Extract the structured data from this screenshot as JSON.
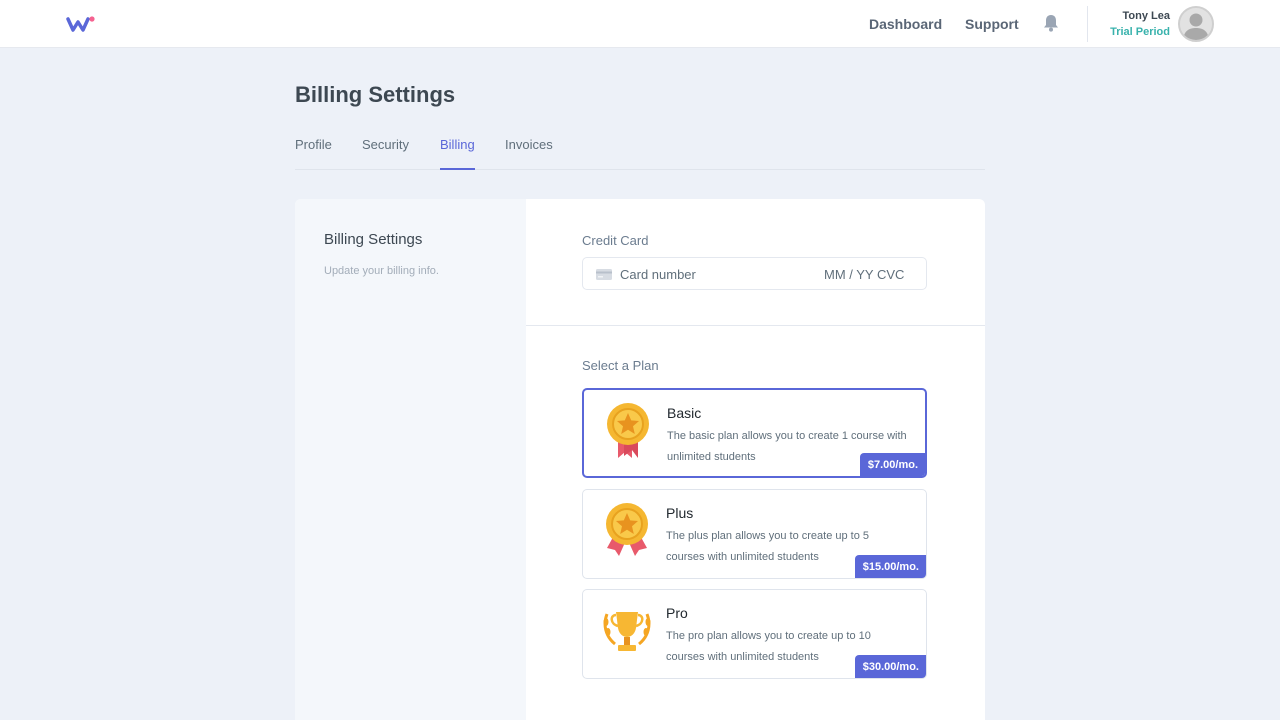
{
  "nav": {
    "links": {
      "dashboard": "Dashboard",
      "support": "Support"
    },
    "user": {
      "name": "Tony Lea",
      "status": "Trial Period"
    },
    "icons": {
      "logo": "wave-logo-icon",
      "notifications": "bell-icon",
      "avatar": "user-avatar-icon"
    }
  },
  "page": {
    "title": "Billing Settings",
    "tabs": [
      "Profile",
      "Security",
      "Billing",
      "Invoices"
    ],
    "active_tab": "Billing"
  },
  "card": {
    "side": {
      "title": "Billing Settings",
      "description": "Update your billing info."
    },
    "credit_card": {
      "label": "Credit Card",
      "placeholder": "Card number",
      "expiry_cvc": "MM / YY  CVC"
    },
    "plans_label": "Select a Plan",
    "plans": [
      {
        "name": "Basic",
        "description": "The basic plan allows you to create 1 course with unlimited students",
        "price": "$7.00/mo.",
        "icon": "medal-ribbon-icon"
      },
      {
        "name": "Plus",
        "description": "The plus plan allows you to create up to 5 courses with unlimited students",
        "price": "$15.00/mo.",
        "icon": "medal-double-ribbon-icon"
      },
      {
        "name": "Pro",
        "description": "The pro plan allows you to create up to 10 courses with unlimited students",
        "price": "$30.00/mo.",
        "icon": "trophy-icon"
      }
    ]
  },
  "colors": {
    "accent": "#5a67d8",
    "trial": "#38b2ac",
    "background": "#edf1f8"
  }
}
